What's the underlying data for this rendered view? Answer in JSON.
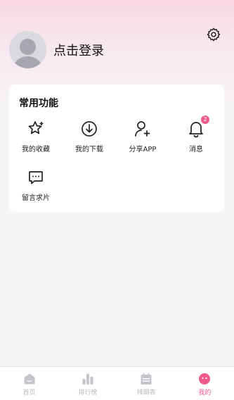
{
  "profile": {
    "login_label": "点击登录"
  },
  "functions": {
    "title": "常用功能",
    "items": [
      {
        "label": "我的收藏",
        "icon": "star-icon"
      },
      {
        "label": "我的下载",
        "icon": "download-icon"
      },
      {
        "label": "分享APP",
        "icon": "add-user-icon"
      },
      {
        "label": "消息",
        "icon": "bell-icon",
        "badge": "2"
      },
      {
        "label": "留言求片",
        "icon": "chat-icon"
      }
    ]
  },
  "tabbar": {
    "items": [
      {
        "label": "首页",
        "icon": "home-icon"
      },
      {
        "label": "排行榜",
        "icon": "ranking-icon"
      },
      {
        "label": "排期表",
        "icon": "calendar-icon"
      },
      {
        "label": "我的",
        "icon": "profile-icon",
        "active": true
      }
    ]
  },
  "colors": {
    "accent": "#f05a8e",
    "gradient_top": "#f9d8e2"
  }
}
